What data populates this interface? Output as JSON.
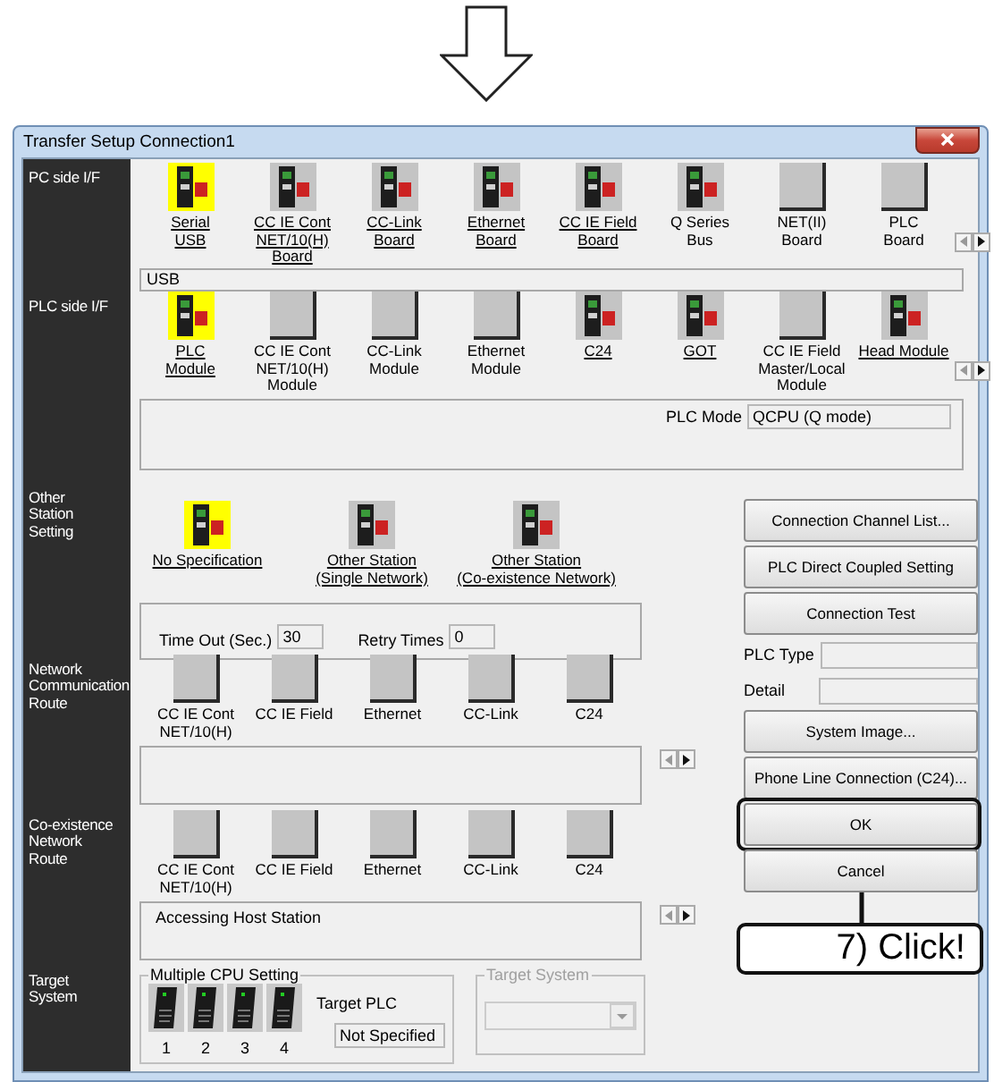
{
  "annotation": {
    "callout": "7) Click!"
  },
  "window": {
    "title": "Transfer Setup Connection1"
  },
  "pc_side": {
    "label": "PC side I/F",
    "selection": "USB",
    "items": [
      {
        "label": "Serial\nUSB",
        "kind": "device",
        "link": true,
        "selected": true
      },
      {
        "label": "CC IE Cont\nNET/10(H)\nBoard",
        "kind": "device",
        "link": true,
        "selected": false
      },
      {
        "label": "CC-Link\nBoard",
        "kind": "device",
        "link": true,
        "selected": false
      },
      {
        "label": "Ethernet\nBoard",
        "kind": "device",
        "link": true,
        "selected": false
      },
      {
        "label": "CC IE Field\nBoard",
        "kind": "device",
        "link": true,
        "selected": false
      },
      {
        "label": "Q Series\nBus",
        "kind": "device",
        "link": false,
        "selected": false
      },
      {
        "label": "NET(II)\nBoard",
        "kind": "blank",
        "link": false,
        "selected": false
      },
      {
        "label": "PLC\nBoard",
        "kind": "blank",
        "link": false,
        "selected": false
      }
    ]
  },
  "plc_side": {
    "label": "PLC side I/F",
    "plc_mode_label": "PLC Mode",
    "plc_mode": "QCPU (Q mode)",
    "items": [
      {
        "label": "PLC\nModule",
        "kind": "device",
        "link": true,
        "selected": true
      },
      {
        "label": "CC IE Cont\nNET/10(H)\nModule",
        "kind": "blank",
        "link": false,
        "selected": false
      },
      {
        "label": "CC-Link\nModule",
        "kind": "blank",
        "link": false,
        "selected": false
      },
      {
        "label": "Ethernet\nModule",
        "kind": "blank",
        "link": false,
        "selected": false
      },
      {
        "label": "C24",
        "kind": "device",
        "link": true,
        "selected": false
      },
      {
        "label": "GOT",
        "kind": "device",
        "link": true,
        "selected": false
      },
      {
        "label": "CC IE Field\nMaster/Local\nModule",
        "kind": "blank",
        "link": false,
        "selected": false
      },
      {
        "label": "Head Module",
        "kind": "device",
        "link": true,
        "selected": false
      }
    ]
  },
  "other_station": {
    "label": "Other\nStation\nSetting",
    "timeout_label": "Time Out (Sec.)",
    "timeout": "30",
    "retry_label": "Retry Times",
    "retry": "0",
    "items": [
      {
        "label": "No Specification",
        "kind": "device",
        "link": true,
        "selected": true
      },
      {
        "label": "Other Station\n(Single Network)",
        "kind": "device",
        "link": true,
        "selected": false
      },
      {
        "label": "Other Station\n(Co-existence Network)",
        "kind": "device",
        "link": true,
        "selected": false
      }
    ]
  },
  "network_route": {
    "label": "Network\nCommunication\nRoute",
    "items": [
      {
        "label": "CC IE Cont\nNET/10(H)",
        "kind": "blank",
        "link": false,
        "selected": false
      },
      {
        "label": "CC IE Field",
        "kind": "blank",
        "link": false,
        "selected": false
      },
      {
        "label": "Ethernet",
        "kind": "blank",
        "link": false,
        "selected": false
      },
      {
        "label": "CC-Link",
        "kind": "blank",
        "link": false,
        "selected": false
      },
      {
        "label": "C24",
        "kind": "blank",
        "link": false,
        "selected": false
      }
    ]
  },
  "coexistence_route": {
    "label": "Co-existence\nNetwork\nRoute",
    "message": "Accessing Host Station",
    "items": [
      {
        "label": "CC IE Cont\nNET/10(H)",
        "kind": "blank",
        "link": false,
        "selected": false
      },
      {
        "label": "CC IE Field",
        "kind": "blank",
        "link": false,
        "selected": false
      },
      {
        "label": "Ethernet",
        "kind": "blank",
        "link": false,
        "selected": false
      },
      {
        "label": "CC-Link",
        "kind": "blank",
        "link": false,
        "selected": false
      },
      {
        "label": "C24",
        "kind": "blank",
        "link": false,
        "selected": false
      }
    ]
  },
  "target_system": {
    "label": "Target\nSystem",
    "multiple_cpu": {
      "title": "Multiple CPU Setting",
      "cpus": [
        "1",
        "2",
        "3",
        "4"
      ],
      "target_label": "Target PLC",
      "target": "Not Specified"
    },
    "target_box": {
      "title": "Target System",
      "disabled": true
    }
  },
  "side_panel": [
    {
      "kind": "button",
      "label": "Connection Channel List..."
    },
    {
      "kind": "button",
      "label": "PLC Direct Coupled Setting"
    },
    {
      "kind": "button",
      "label": "Connection Test"
    },
    {
      "kind": "field",
      "label": "PLC Type"
    },
    {
      "kind": "field",
      "label": "Detail"
    },
    {
      "kind": "button",
      "label": "System Image..."
    },
    {
      "kind": "button",
      "label": "Phone Line Connection (C24)..."
    },
    {
      "kind": "button",
      "label": "OK",
      "highlighted": true
    },
    {
      "kind": "button",
      "label": "Cancel"
    }
  ]
}
